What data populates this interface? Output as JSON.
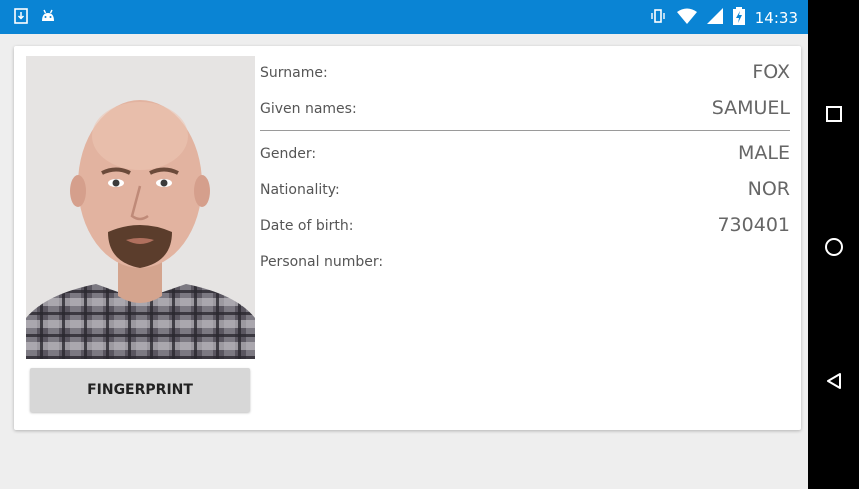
{
  "status_bar": {
    "time": "14:33",
    "icons": [
      "download-icon",
      "android-icon",
      "vibrate-icon",
      "wifi-icon",
      "signal-icon",
      "battery-charging-icon"
    ]
  },
  "card": {
    "fingerprint_button": "FINGERPRINT",
    "fields_top": [
      {
        "label": "Surname:",
        "value": "FOX"
      },
      {
        "label": "Given names:",
        "value": "SAMUEL"
      }
    ],
    "fields_bottom": [
      {
        "label": "Gender:",
        "value": "MALE"
      },
      {
        "label": "Nationality:",
        "value": "NOR"
      },
      {
        "label": "Date of birth:",
        "value": "730401"
      },
      {
        "label": "Personal number:",
        "value": ""
      }
    ]
  },
  "navigation": [
    "recents-button",
    "home-button",
    "back-button"
  ],
  "colors": {
    "status_bar": "#0a84d4",
    "nav_bar": "#000000",
    "background": "#eeeeee",
    "card": "#ffffff",
    "button": "#d7d7d7"
  }
}
